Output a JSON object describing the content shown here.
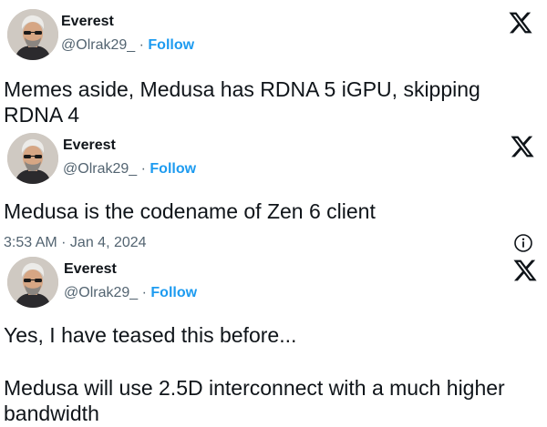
{
  "tweets": [
    {
      "author": {
        "name": "Everest",
        "handle": "@Olrak29_",
        "separator": "·",
        "follow_label": "Follow"
      },
      "text": "Memes aside, Medusa has RDNA 5 iGPU, skipping RDNA 4",
      "icon": "x-logo-icon"
    },
    {
      "author": {
        "name": "Everest",
        "handle": "@Olrak29_",
        "separator": "·",
        "follow_label": "Follow"
      },
      "text": "Medusa is the codename of Zen 6 client",
      "timestamp": "3:53 AM · Jan 4, 2024",
      "icon": "x-logo-icon",
      "info_icon": "info-icon"
    },
    {
      "author": {
        "name": "Everest",
        "handle": "@Olrak29_",
        "separator": "·",
        "follow_label": "Follow"
      },
      "text_line1": "Yes, I have teased this before...",
      "text_line2": "Medusa will use 2.5D interconnect with a much higher bandwidth",
      "icon": "x-logo-icon"
    }
  ],
  "colors": {
    "text": "#0f1419",
    "muted": "#536471",
    "follow": "#1d9bf0"
  }
}
